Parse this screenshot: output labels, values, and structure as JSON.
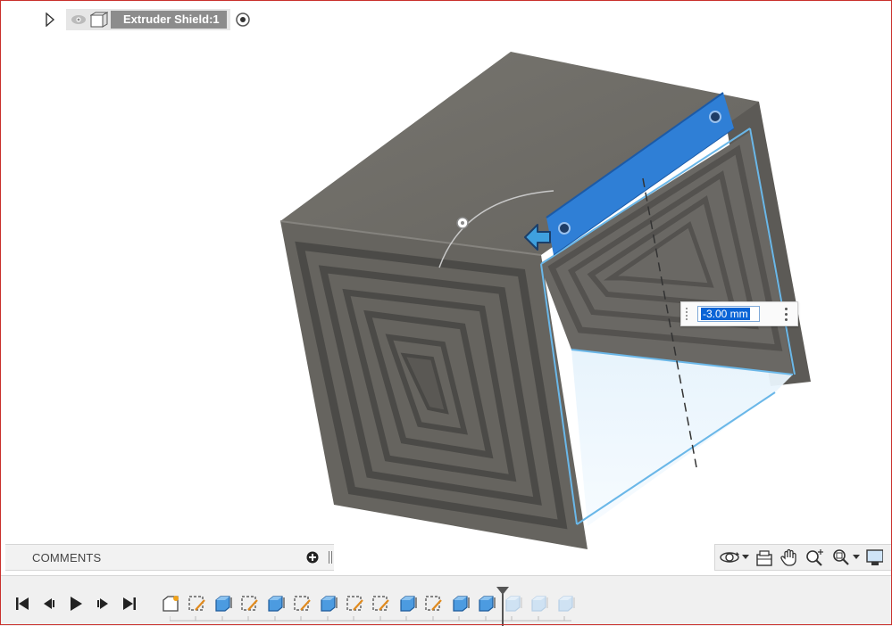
{
  "browser": {
    "component_label": "Extruder Shield:1"
  },
  "dimension": {
    "value": "-3.00 mm"
  },
  "comments": {
    "label": "COMMENTS"
  },
  "navbar": {
    "tools": [
      "orbit-icon",
      "look-at-icon",
      "pan-icon",
      "zoom-icon",
      "fit-icon",
      "display-settings-icon"
    ]
  },
  "timeline": {
    "controls": [
      "go-to-start",
      "step-back",
      "play",
      "step-forward",
      "go-to-end"
    ],
    "features": [
      "sketch",
      "sketch",
      "extrude",
      "sketch",
      "extrude",
      "sketch",
      "extrude",
      "sketch",
      "sketch",
      "extrude",
      "sketch",
      "extrude",
      "extrude",
      "extrude",
      "extrude",
      "extrude"
    ],
    "active_count": 13
  },
  "colors": {
    "selection_blue": "#2f7fd6",
    "model_gray": "#6e6c68",
    "accent_red": "#c9302c"
  }
}
